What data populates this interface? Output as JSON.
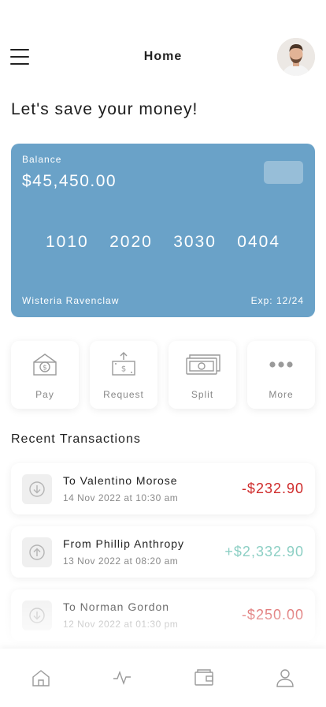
{
  "header": {
    "title": "Home",
    "menu_icon": "hamburger-menu-icon",
    "avatar_icon": "user-avatar-photo"
  },
  "headline": "Let's save your money!",
  "card": {
    "balance_label": "Balance",
    "balance_value": "$45,450.00",
    "number_groups": [
      "1010",
      "2020",
      "3030",
      "0404"
    ],
    "holder": "Wisteria Ravenclaw",
    "expiry": "Exp: 12/24",
    "color": "#6aa2c8"
  },
  "actions": [
    {
      "label": "Pay",
      "icon": "pay-icon"
    },
    {
      "label": "Request",
      "icon": "request-icon"
    },
    {
      "label": "Split",
      "icon": "split-icon"
    },
    {
      "label": "More",
      "icon": "more-icon"
    }
  ],
  "recent": {
    "title": "Recent Transactions",
    "items": [
      {
        "name": "To Valentino Morose",
        "date": "14 Nov 2022 at 10:30 am",
        "amount": "-$232.90",
        "direction": "out",
        "icon": "arrow-down-circle-icon"
      },
      {
        "name": "From Phillip Anthropy",
        "date": "13 Nov 2022 at 08:20 am",
        "amount": "+$2,332.90",
        "direction": "in",
        "icon": "arrow-up-circle-icon"
      },
      {
        "name": "To Norman Gordon",
        "date": "12 Nov 2022 at 01:30 pm",
        "amount": "-$250.00",
        "direction": "out",
        "icon": "arrow-down-circle-icon"
      }
    ]
  },
  "tabbar": [
    {
      "icon": "home-icon"
    },
    {
      "icon": "activity-icon"
    },
    {
      "icon": "wallet-icon"
    },
    {
      "icon": "profile-icon"
    }
  ],
  "colors": {
    "negative": "#cf2b2b",
    "positive": "#8ccfc4",
    "card": "#6aa2c8"
  }
}
